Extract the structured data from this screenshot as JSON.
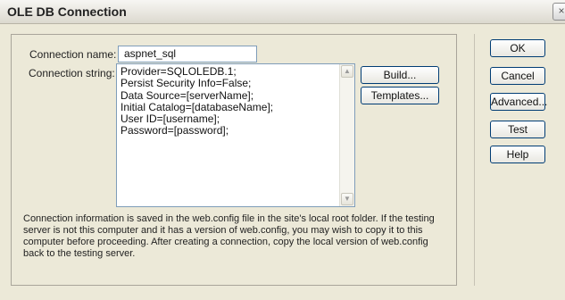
{
  "window": {
    "title": "OLE DB Connection",
    "close_glyph": "×"
  },
  "form": {
    "connection_name_label": "Connection name:",
    "connection_name_value": "aspnet_sql",
    "connection_string_label": "Connection string:",
    "connection_string_value": "Provider=SQLOLEDB.1;\nPersist Security Info=False;\nData Source=[serverName];\nInitial Catalog=[databaseName];\nUser ID=[username];\nPassword=[password];"
  },
  "buttons": {
    "build": "Build...",
    "templates": "Templates...",
    "ok": "OK",
    "cancel": "Cancel",
    "advanced": "Advanced...",
    "test": "Test",
    "help": "Help"
  },
  "info_text": "Connection information is saved in the web.config file in the site's local root folder. If the testing server is not this computer and it has a version of web.config, you may wish to copy it to this computer before proceeding. After creating a connection, copy the local version of web.config back to the testing server.",
  "icons": {
    "scroll_up": "▲",
    "scroll_down": "▼"
  }
}
